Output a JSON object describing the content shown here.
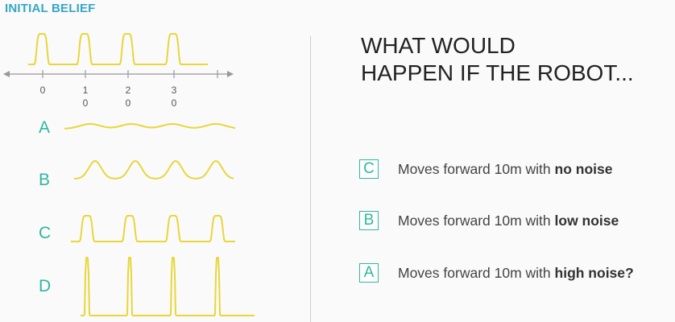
{
  "header": {
    "title": "INITIAL BELIEF"
  },
  "axis": {
    "ticks": [
      {
        "top": "0",
        "bottom": ""
      },
      {
        "top": "1",
        "bottom": "0"
      },
      {
        "top": "2",
        "bottom": "0"
      },
      {
        "top": "3",
        "bottom": "0"
      }
    ]
  },
  "rows": [
    {
      "label": "A",
      "shape": "wavy-low"
    },
    {
      "label": "B",
      "shape": "broad-peaks"
    },
    {
      "label": "C",
      "shape": "medium-peaks"
    },
    {
      "label": "D",
      "shape": "sharp-spikes"
    }
  ],
  "curve_color": "#e8d63a",
  "accent_color": "#2eb8a0",
  "question": {
    "line1": "WHAT WOULD",
    "line2": "HAPPEN IF THE ROBOT..."
  },
  "options": [
    {
      "badge": "C",
      "text": "Moves forward 10m with ",
      "bold": "no noise"
    },
    {
      "badge": "B",
      "text": "Moves forward 10m with ",
      "bold": "low noise"
    },
    {
      "badge": "A",
      "text": "Moves forward 10m with ",
      "bold": "high noise?"
    }
  ]
}
